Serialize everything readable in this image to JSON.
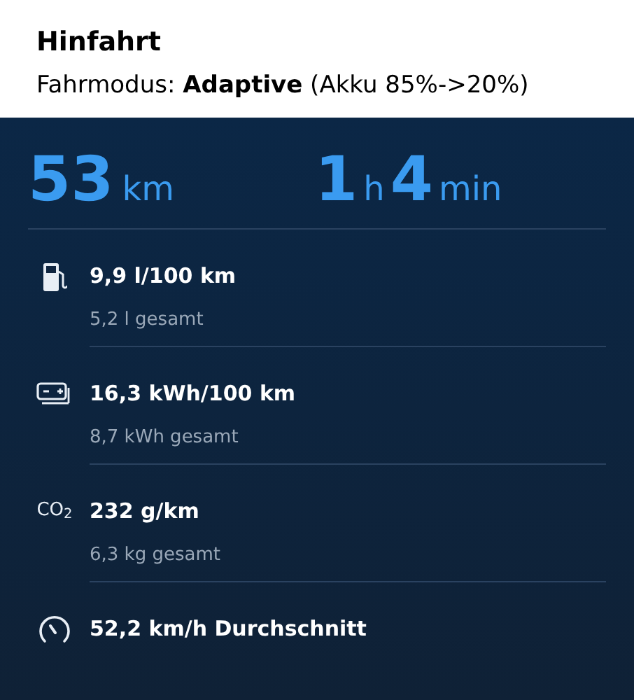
{
  "header": {
    "title": "Hinfahrt",
    "subtitle": "Fahrmodus: **Adaptive** (Akku 85%->20%)"
  },
  "summary": [
    {
      "value": "53",
      "unit": "km"
    },
    {
      "value": "1",
      "unit": "h"
    },
    {
      "value": "4",
      "unit": "min"
    }
  ],
  "rows": [
    {
      "kind": "fuel",
      "title": "9,9 l/100 km",
      "detail": "5,2 l gesamt"
    },
    {
      "kind": "battery",
      "title": "16,3 kWh/100 km",
      "detail": "8,7 kWh gesamt"
    },
    {
      "kind": "co2",
      "icon_text": "CO$_{2}$",
      "title": "232 g/km",
      "detail": "6,3 kg gesamt"
    },
    {
      "kind": "gauge",
      "title": "52,2 km/h Durchschnitt"
    }
  ]
}
